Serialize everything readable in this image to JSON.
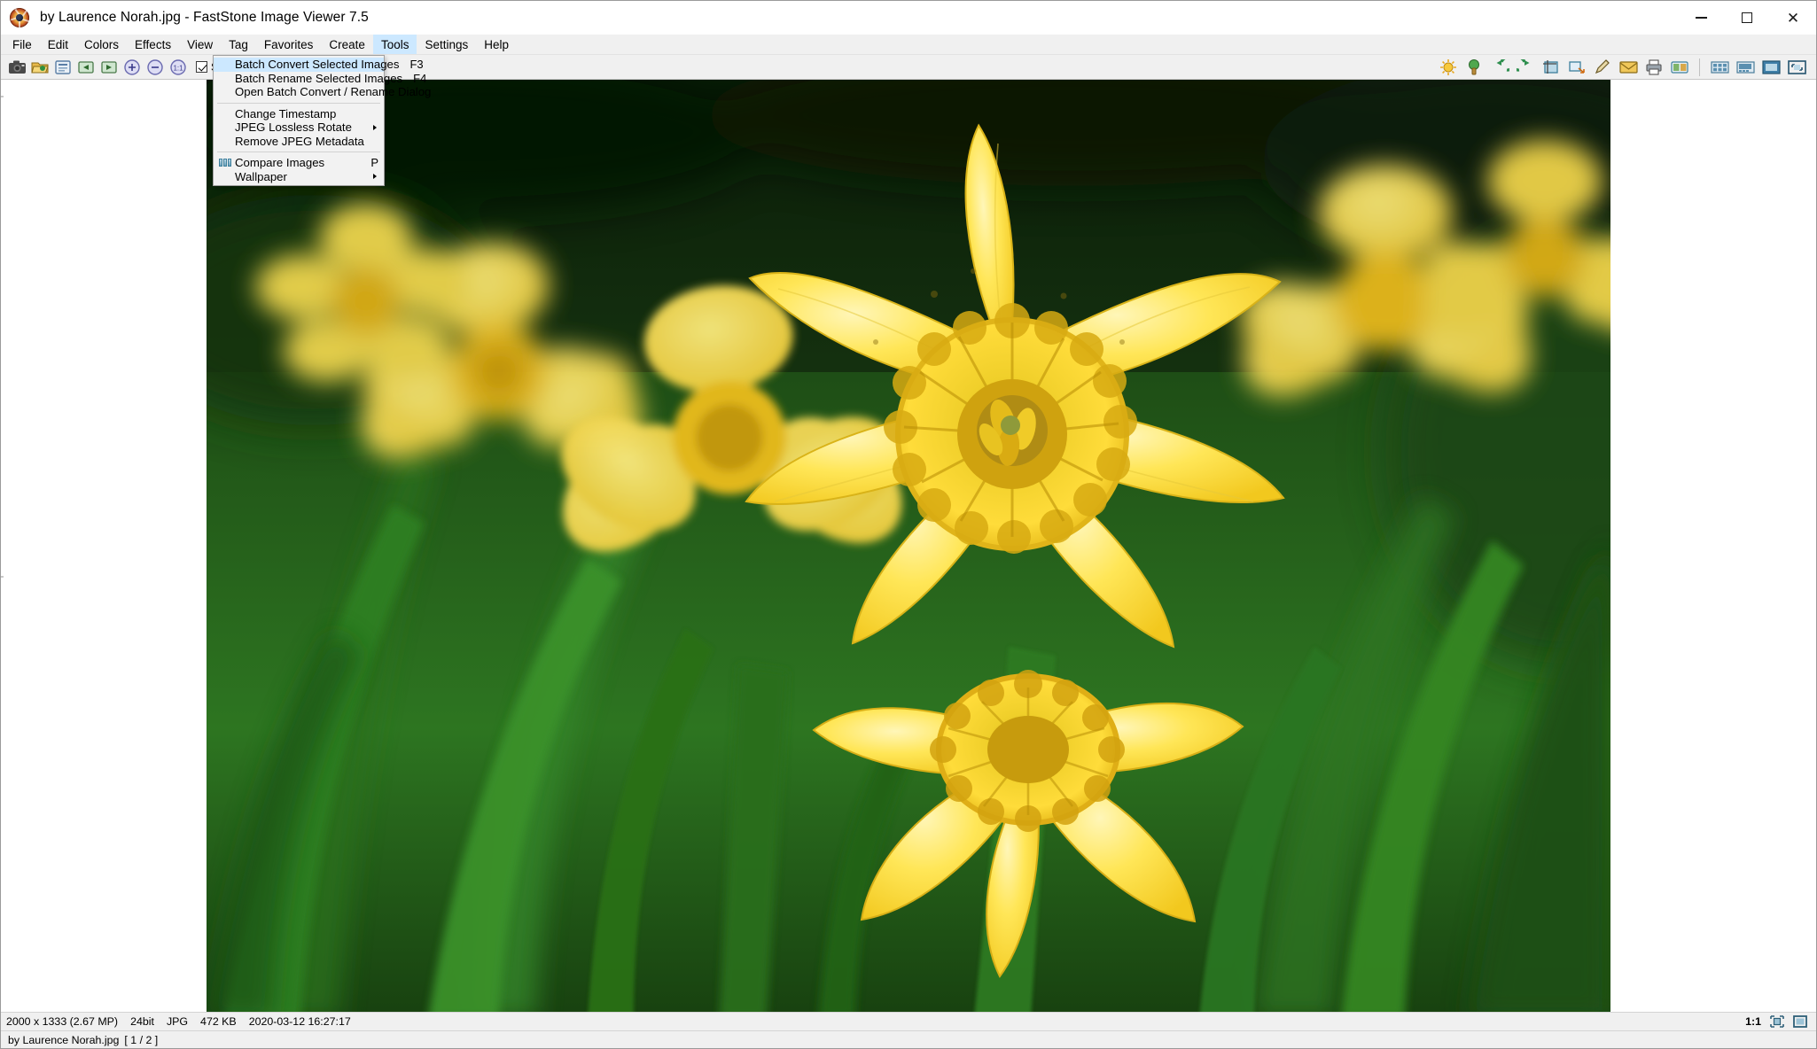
{
  "window": {
    "title": "by Laurence Norah.jpg  -  FastStone Image Viewer 7.5",
    "app_icon": "faststone-logo-icon",
    "controls": {
      "minimize": "minimize-icon",
      "maximize": "maximize-icon",
      "close": "close-icon"
    }
  },
  "menubar": {
    "items": [
      {
        "label": "File",
        "active": false
      },
      {
        "label": "Edit",
        "active": false
      },
      {
        "label": "Colors",
        "active": false
      },
      {
        "label": "Effects",
        "active": false
      },
      {
        "label": "View",
        "active": false
      },
      {
        "label": "Tag",
        "active": false
      },
      {
        "label": "Favorites",
        "active": false
      },
      {
        "label": "Create",
        "active": false
      },
      {
        "label": "Tools",
        "active": true
      },
      {
        "label": "Settings",
        "active": false
      },
      {
        "label": "Help",
        "active": false
      }
    ]
  },
  "toolbar": {
    "left_buttons": [
      {
        "name": "screen-capture-icon",
        "title": "Screen Capture"
      },
      {
        "name": "open-folder-icon",
        "title": "Open Folder"
      },
      {
        "name": "save-icon",
        "title": "Save"
      },
      {
        "name": "previous-image-icon",
        "title": "Previous Image"
      },
      {
        "name": "next-image-icon",
        "title": "Next Image"
      },
      {
        "name": "zoom-in-icon",
        "title": "Zoom In"
      },
      {
        "name": "zoom-out-icon",
        "title": "Zoom Out"
      },
      {
        "name": "actual-size-icon",
        "title": "Actual Size 1:1"
      }
    ],
    "smooth_checkbox": {
      "label": "Smoo",
      "checked": true
    },
    "right_buttons": [
      {
        "name": "brightness-sun-icon",
        "title": "Adjust Lighting"
      },
      {
        "name": "color-picker-icon",
        "title": "Adjust Colors"
      },
      {
        "name": "rotate-left-icon",
        "title": "Rotate Left"
      },
      {
        "name": "rotate-right-icon",
        "title": "Rotate Right"
      },
      {
        "name": "crop-icon",
        "title": "Crop Board"
      },
      {
        "name": "resize-icon",
        "title": "Resize / Resample"
      },
      {
        "name": "draw-icon",
        "title": "Draw Board"
      },
      {
        "name": "email-icon",
        "title": "E-mail"
      },
      {
        "name": "print-icon",
        "title": "Print"
      },
      {
        "name": "compare-icon",
        "title": "Compare Images"
      }
    ],
    "far_right_buttons": [
      {
        "name": "thumbnail-view-icon",
        "title": "Thumbnail Browser"
      },
      {
        "name": "filmstrip-icon",
        "title": "Filmstrip"
      },
      {
        "name": "fullscreen-icon",
        "title": "Full Screen"
      },
      {
        "name": "fit-window-icon",
        "title": "Fit to Window"
      }
    ]
  },
  "tools_menu": {
    "open": true,
    "groups": [
      {
        "items": [
          {
            "label": "Batch Convert Selected Images",
            "shortcut": "F3",
            "highlighted": true,
            "submenu": false,
            "icon": null
          },
          {
            "label": "Batch Rename Selected Images",
            "shortcut": "F4",
            "highlighted": false,
            "submenu": false,
            "icon": null
          },
          {
            "label": "Open Batch Convert / Rename Dialog",
            "shortcut": "",
            "highlighted": false,
            "submenu": false,
            "icon": null
          }
        ]
      },
      {
        "items": [
          {
            "label": "Change Timestamp",
            "shortcut": "",
            "highlighted": false,
            "submenu": false,
            "icon": null
          },
          {
            "label": "JPEG Lossless Rotate",
            "shortcut": "",
            "highlighted": false,
            "submenu": true,
            "icon": null
          },
          {
            "label": "Remove JPEG Metadata",
            "shortcut": "",
            "highlighted": false,
            "submenu": false,
            "icon": null
          }
        ]
      },
      {
        "items": [
          {
            "label": "Compare Images",
            "shortcut": "P",
            "highlighted": false,
            "submenu": false,
            "icon": "compare-images-icon"
          },
          {
            "label": "Wallpaper",
            "shortcut": "",
            "highlighted": false,
            "submenu": true,
            "icon": null
          }
        ]
      }
    ]
  },
  "image": {
    "alt": "Close-up photograph of yellow daffodil flowers in a green field",
    "dimensions": "2000 x 1333 (2.67 MP)",
    "bit_depth": "24bit",
    "format": "JPG",
    "file_size": "472 KB",
    "timestamp": "2020-03-12 16:27:17"
  },
  "statusbar": {
    "zoom_ratio": "1:1",
    "buttons": [
      {
        "name": "fit-to-window-icon",
        "title": "Fit To Window"
      },
      {
        "name": "actual-size-icon",
        "title": "Actual Size"
      }
    ]
  },
  "statusbar_bottom": {
    "filename": "by Laurence Norah.jpg",
    "counter": "[ 1 / 2 ]"
  },
  "colors": {
    "menu_highlight": "#cce8ff",
    "chrome_bg": "#f0f0f0",
    "menu_bg": "#f2f2f2",
    "border": "#a0a0a0",
    "text": "#000000"
  }
}
